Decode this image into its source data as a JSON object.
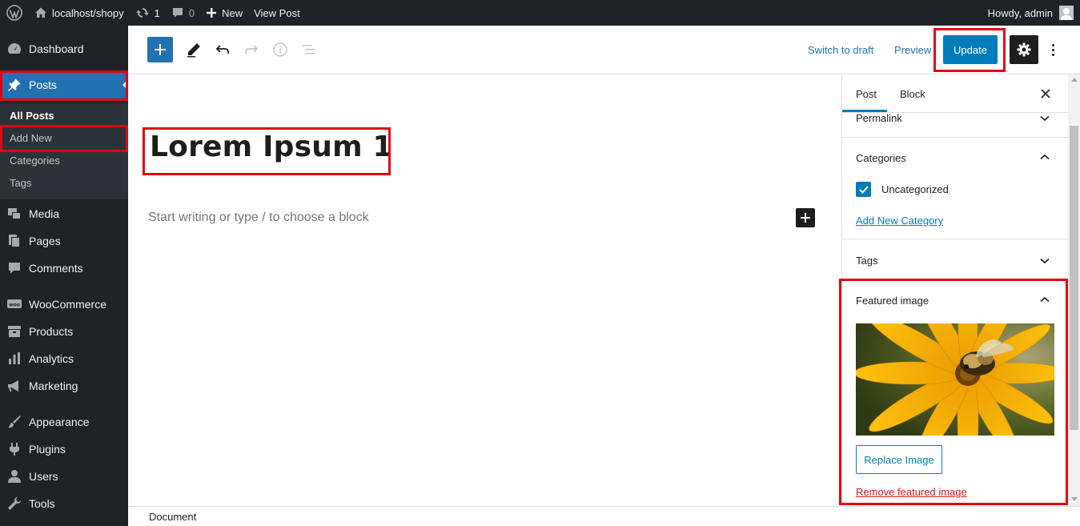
{
  "admin_bar": {
    "site_name": "localhost/shopy",
    "updates_count": "1",
    "comments_count": "0",
    "new_label": "New",
    "view_post_label": "View Post",
    "greeting": "Howdy, admin"
  },
  "sidebar": {
    "dashboard": "Dashboard",
    "posts": "Posts",
    "submenu": {
      "all_posts": "All Posts",
      "add_new": "Add New",
      "categories": "Categories",
      "tags": "Tags"
    },
    "media": "Media",
    "pages": "Pages",
    "comments": "Comments",
    "woocommerce": "WooCommerce",
    "products": "Products",
    "analytics": "Analytics",
    "marketing": "Marketing",
    "appearance": "Appearance",
    "plugins": "Plugins",
    "users": "Users",
    "tools": "Tools"
  },
  "header": {
    "switch_to_draft": "Switch to draft",
    "preview": "Preview",
    "update": "Update"
  },
  "editor": {
    "post_title": "Lorem Ipsum 1",
    "placeholder": "Start writing or type / to choose a block"
  },
  "settings_panel": {
    "tab_post": "Post",
    "tab_block": "Block",
    "permalink": "Permalink",
    "categories_title": "Categories",
    "category_item": "Uncategorized",
    "category_checked": true,
    "add_new_category": "Add New Category",
    "tags_title": "Tags",
    "featured_image_title": "Featured image",
    "replace_image": "Replace Image",
    "remove_featured_image": "Remove featured image"
  },
  "footer": {
    "breadcrumb": "Document"
  },
  "colors": {
    "admin_dark": "#1d2327",
    "accent_blue": "#2271b1",
    "button_blue": "#007cba",
    "highlight_red": "#e30613",
    "danger_red": "#cc1818"
  }
}
